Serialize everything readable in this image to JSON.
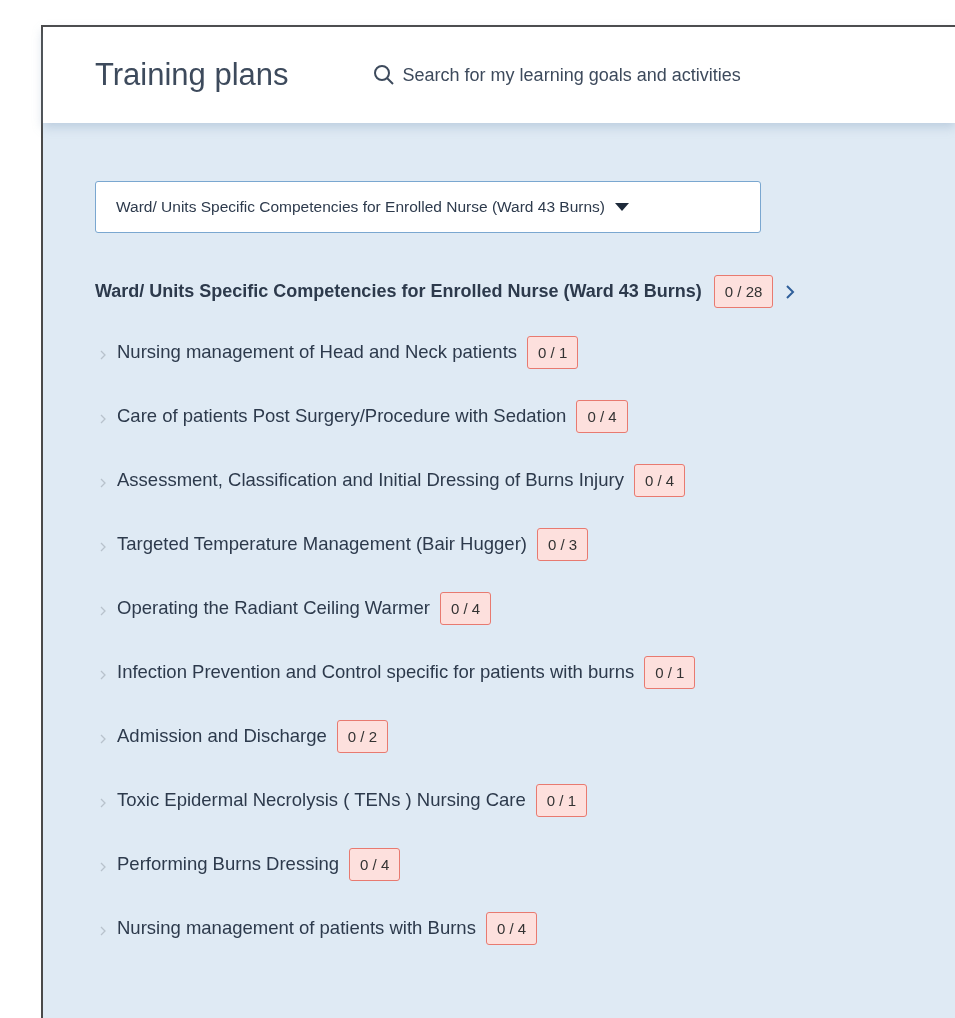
{
  "header": {
    "title": "Training plans",
    "search": {
      "placeholder": "Search for my learning goals and activities"
    }
  },
  "plan_select": {
    "value": "Ward/ Units Specific Competencies for Enrolled Nurse (Ward 43 Burns)"
  },
  "plan": {
    "title": "Ward/ Units Specific Competencies for Enrolled Nurse (Ward 43 Burns)",
    "count": "0 / 28"
  },
  "goals": [
    {
      "label": "Nursing management of Head and Neck patients",
      "count": "0 / 1",
      "expanded": false
    },
    {
      "label": "Care of patients Post Surgery/Procedure with Sedation",
      "count": "0 / 4",
      "expanded": false
    },
    {
      "label": "Assessment, Classification and Initial Dressing of Burns Injury",
      "count": "0 / 4",
      "expanded": false
    },
    {
      "label": "Targeted Temperature Management (Bair Hugger)",
      "count": "0 / 3",
      "expanded": false
    },
    {
      "label": "Operating the Radiant Ceiling Warmer",
      "count": "0 / 4",
      "expanded": false
    },
    {
      "label": "Infection Prevention and Control specific for patients with burns",
      "count": "0 / 1",
      "expanded": false
    },
    {
      "label": "Admission and Discharge",
      "count": "0 / 2",
      "expanded": false
    },
    {
      "label": "Toxic Epidermal Necrolysis ( TENs ) Nursing Care",
      "count": "0 / 1",
      "expanded": false
    },
    {
      "label": "Performing Burns Dressing",
      "count": "0 / 4",
      "expanded": false
    },
    {
      "label": "Nursing management of patients with Burns",
      "count": "0 / 4",
      "expanded": false
    }
  ]
}
